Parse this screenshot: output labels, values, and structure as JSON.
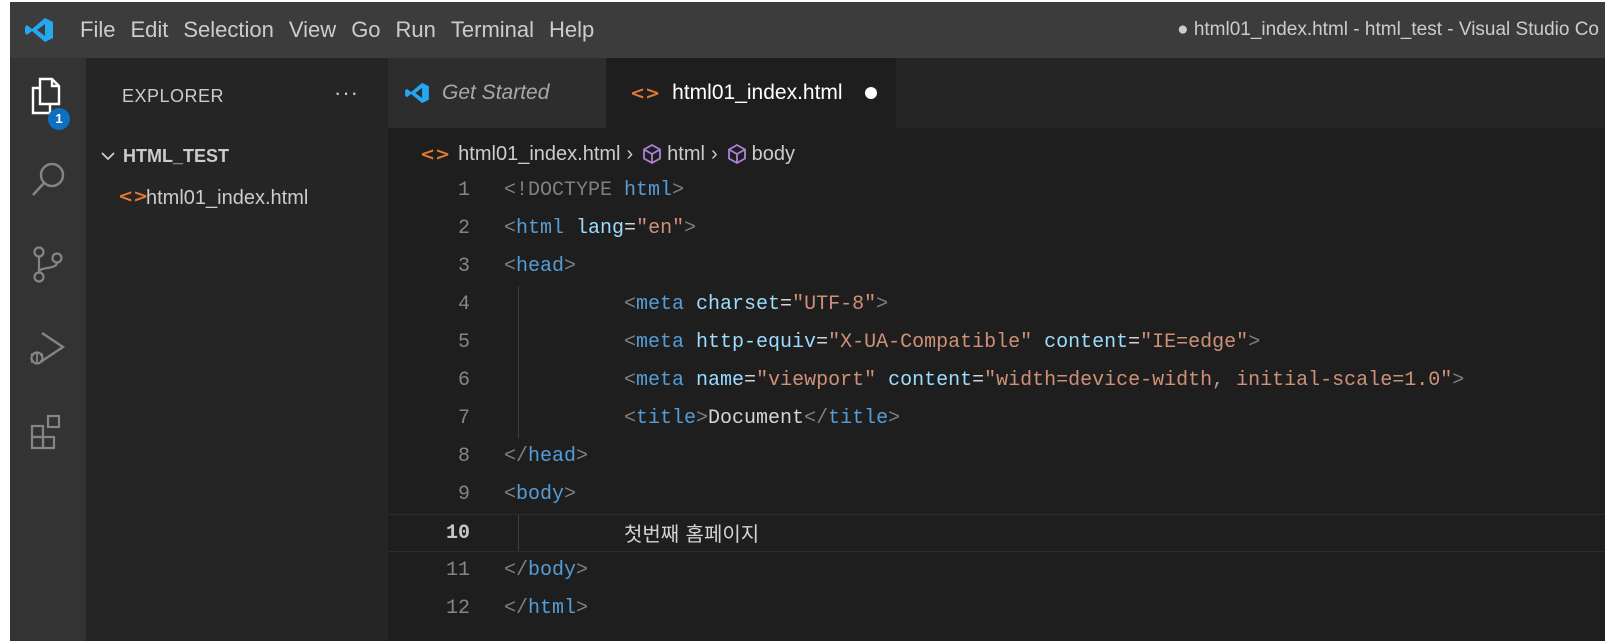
{
  "app": {
    "window_title": "● html01_index.html - html_test - Visual Studio Co",
    "accent": "#0e70c0"
  },
  "menu": {
    "items": [
      "File",
      "Edit",
      "Selection",
      "View",
      "Go",
      "Run",
      "Terminal",
      "Help"
    ]
  },
  "activity_bar": {
    "items": [
      "explorer-icon",
      "search-icon",
      "source-control-icon",
      "run-debug-icon",
      "extensions-icon"
    ],
    "explorer_badge": "1"
  },
  "sidebar": {
    "header": "EXPLORER",
    "more": "···",
    "folder": "HTML_TEST",
    "files": [
      "html01_index.html"
    ]
  },
  "tabs": [
    {
      "label": "Get Started",
      "active": false
    },
    {
      "label": "html01_index.html",
      "active": true,
      "modified": true
    }
  ],
  "breadcrumb": {
    "file": "html01_index.html",
    "seg1": "html",
    "seg2": "body"
  },
  "editor": {
    "current_line": 10,
    "lines": [
      {
        "n": "1",
        "t1": "<!DOCTYPE ",
        "t2": "html",
        "t3": ">"
      },
      {
        "n": "2",
        "t1": "<",
        "t2": "html",
        "t3": " lang",
        "t4": "=",
        "t5": "\"en\"",
        "t6": ">"
      },
      {
        "n": "3",
        "t1": "<",
        "t2": "head",
        "t3": ">"
      },
      {
        "n": "4",
        "t1": "<",
        "t2": "meta",
        "t3": " charset",
        "t4": "=",
        "t5": "\"UTF-8\"",
        "t6": ">"
      },
      {
        "n": "5",
        "t1": "<",
        "t2": "meta",
        "t3": " http-equiv",
        "t4": "=",
        "t5": "\"X-UA-Compatible\"",
        "t6": " content",
        "t7": "=",
        "t8": "\"IE=edge\"",
        "t9": ">"
      },
      {
        "n": "6",
        "t1": "<",
        "t2": "meta",
        "t3": " name",
        "t4": "=",
        "t5": "\"viewport\"",
        "t6": " content",
        "t7": "=",
        "t8": "\"width=device-width, initial-scale=1.0\"",
        "t9": ">"
      },
      {
        "n": "7",
        "t1": "<",
        "t2": "title",
        "t3": ">",
        "t4": "Document",
        "t5": "</",
        "t6": "title",
        "t7": ">"
      },
      {
        "n": "8",
        "t1": "</",
        "t2": "head",
        "t3": ">"
      },
      {
        "n": "9",
        "t1": "<",
        "t2": "body",
        "t3": ">"
      },
      {
        "n": "10",
        "t1": "첫번째 홈페이지"
      },
      {
        "n": "11",
        "t1": "</",
        "t2": "body",
        "t3": ">"
      },
      {
        "n": "12",
        "t1": "</",
        "t2": "html",
        "t3": ">"
      }
    ]
  }
}
